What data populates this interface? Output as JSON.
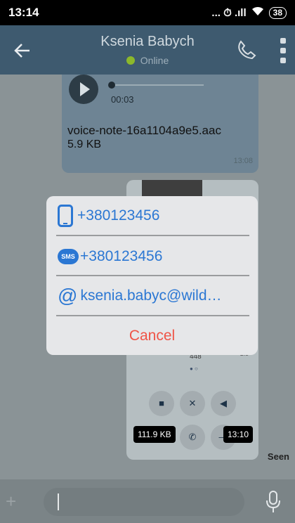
{
  "status_bar": {
    "time": "13:14",
    "signal": "... ⏱ .ıll",
    "battery": "38"
  },
  "header": {
    "name": "Ksenia Babych",
    "status": "Online"
  },
  "voice_message": {
    "duration": "00:03",
    "file_name": "voice-note-16a1104a9e5.aac",
    "file_size": "5.9 KB",
    "time": "13:08"
  },
  "image_message": {
    "size": "111.9 KB",
    "time": "13:10",
    "inner_number": "448",
    "inner_side": "1.5",
    "inner_dots": "● ○"
  },
  "seen_label": "Seen",
  "dialog": {
    "options": [
      {
        "label": "+380123456",
        "icon": "mobile-phone-icon"
      },
      {
        "label": "+380123456",
        "icon": "sms-icon"
      },
      {
        "label": "ksenia.babyc@wild…",
        "icon": "email-at-icon"
      }
    ],
    "cancel_label": "Cancel",
    "sms_badge": "SMS",
    "at_symbol": "@"
  },
  "colors": {
    "accent": "#2b77d3",
    "cancel": "#ef5447",
    "header": "#3e5a6f",
    "arrow": "#e52b1f"
  }
}
